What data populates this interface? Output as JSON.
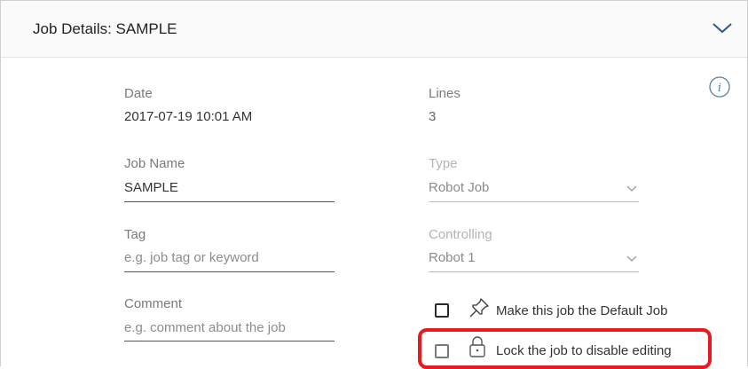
{
  "header": {
    "title": "Job Details: SAMPLE",
    "collapse_icon": "chevron-down-icon",
    "info_icon": "info-icon"
  },
  "fields": {
    "date": {
      "label": "Date",
      "value": "2017-07-19 10:01 AM"
    },
    "lines": {
      "label": "Lines",
      "value": "3"
    },
    "job_name": {
      "label": "Job Name",
      "value": "SAMPLE"
    },
    "type": {
      "label": "Type",
      "value": "Robot Job"
    },
    "tag": {
      "label": "Tag",
      "placeholder": "e.g. job tag or keyword"
    },
    "controlling": {
      "label": "Controlling",
      "value": "Robot 1"
    },
    "comment": {
      "label": "Comment",
      "placeholder": "e.g. comment about the job"
    }
  },
  "options": {
    "default_job": {
      "label": "Make this job the Default Job",
      "icon": "pin-icon",
      "checked": false
    },
    "lock_job": {
      "label": "Lock the job to disable editing",
      "icon": "lock-icon",
      "checked": false
    }
  },
  "colors": {
    "highlight": "#e8191f",
    "info_icon": "#5b7f9e"
  }
}
